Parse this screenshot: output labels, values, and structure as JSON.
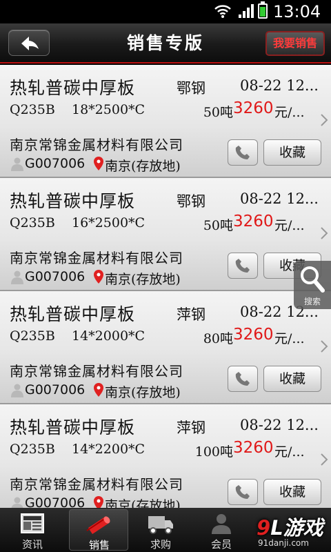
{
  "status_bar": {
    "time": "13:04"
  },
  "header": {
    "title": "销售专版",
    "back_icon": "back-arrow-icon",
    "sell_button": "我要销售"
  },
  "listings": [
    {
      "name": "热轧普碳中厚板",
      "maker": "鄂钢",
      "date": "08-22 12...",
      "grade": "Q235B",
      "spec": "18*2500*C",
      "qty": "50吨",
      "price": "3260",
      "unit": "元/...",
      "company": "南京常锦金属材料有限公司",
      "user_code": "G007006",
      "place": "南京(存放地)",
      "favorite_label": "收藏"
    },
    {
      "name": "热轧普碳中厚板",
      "maker": "鄂钢",
      "date": "08-22 12...",
      "grade": "Q235B",
      "spec": "16*2500*C",
      "qty": "50吨",
      "price": "3260",
      "unit": "元/...",
      "company": "南京常锦金属材料有限公司",
      "user_code": "G007006",
      "place": "南京(存放地)",
      "favorite_label": "收藏"
    },
    {
      "name": "热轧普碳中厚板",
      "maker": "萍钢",
      "date": "08-22 12...",
      "grade": "Q235B",
      "spec": "14*2000*C",
      "qty": "80吨",
      "price": "3260",
      "unit": "元/...",
      "company": "南京常锦金属材料有限公司",
      "user_code": "G007006",
      "place": "南京(存放地)",
      "favorite_label": "收藏"
    },
    {
      "name": "热轧普碳中厚板",
      "maker": "萍钢",
      "date": "08-22 12...",
      "grade": "Q235B",
      "spec": "14*2200*C",
      "qty": "100吨",
      "price": "3260",
      "unit": "元/...",
      "company": "南京常锦金属材料有限公司",
      "user_code": "G007006",
      "place": "南京(存放地)",
      "favorite_label": "收藏"
    }
  ],
  "search_fab": {
    "label": "搜索"
  },
  "tabs": [
    {
      "label": "资讯",
      "icon": "news-icon"
    },
    {
      "label": "销售",
      "icon": "steel-pipe-icon",
      "active": true
    },
    {
      "label": "求购",
      "icon": "truck-icon"
    },
    {
      "label": "会员",
      "icon": "member-icon"
    }
  ],
  "watermark": {
    "logo_prefix": "9",
    "logo_text": "L游戏",
    "url": "91danji.com"
  },
  "colors": {
    "accent_red": "#e01818",
    "header_border": "#b11111"
  }
}
